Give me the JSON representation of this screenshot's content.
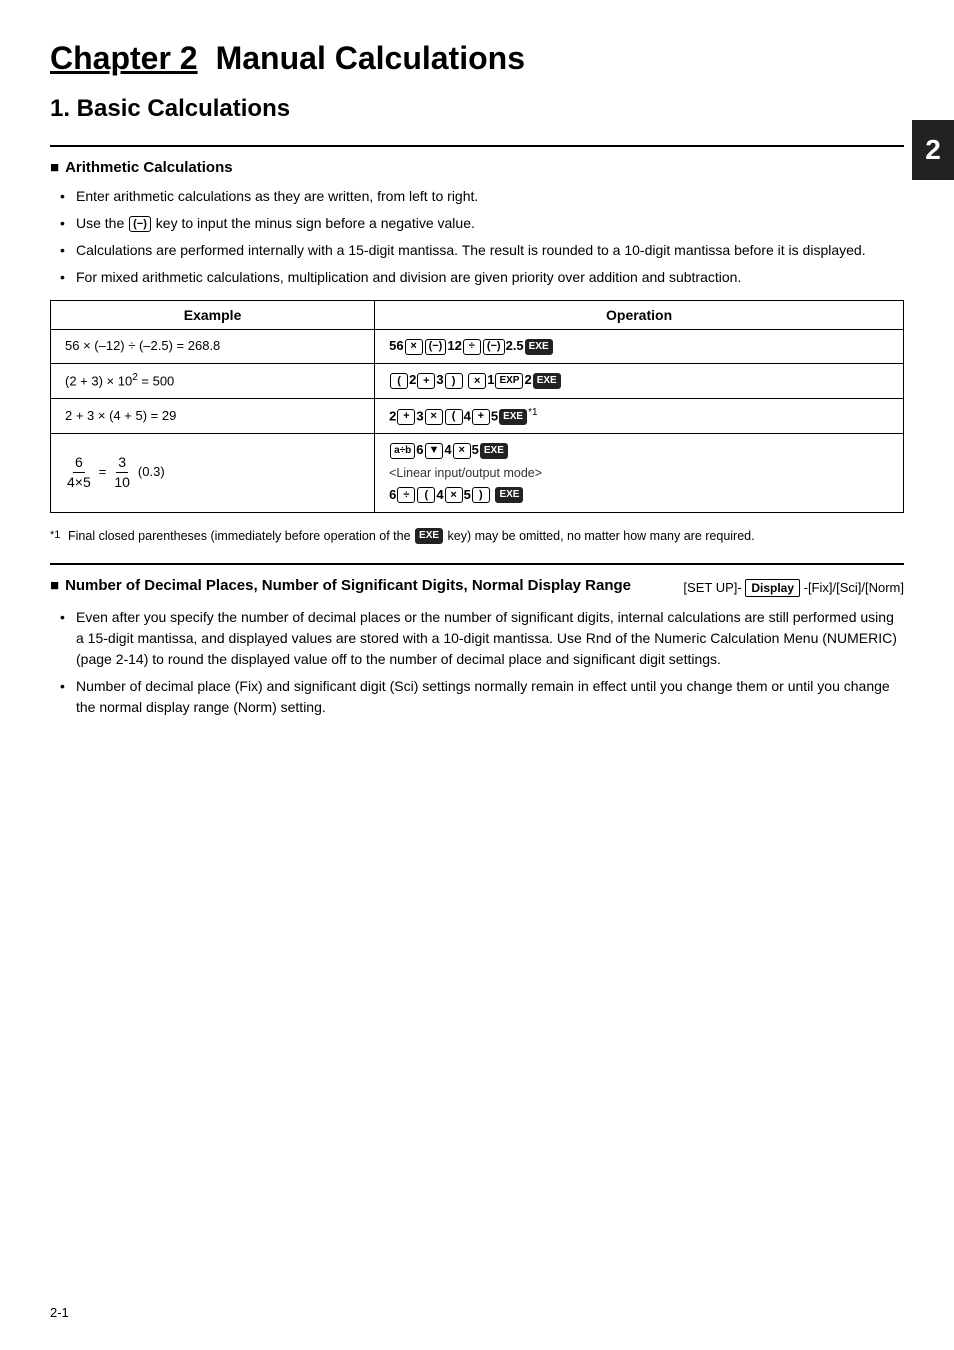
{
  "chapter": {
    "label": "Chapter 2",
    "title": "Manual Calculations",
    "section_tab": "2"
  },
  "section1": {
    "heading": "1. Basic Calculations"
  },
  "arithmetic": {
    "heading": "Arithmetic Calculations",
    "bullets": [
      "Enter arithmetic calculations as they are written, from left to right.",
      "Use the (−) key to input the minus sign before a negative value.",
      "Calculations are performed internally with a 15-digit mantissa. The result is rounded to a 10-digit mantissa before it is displayed.",
      "For mixed arithmetic calculations, multiplication and division are given priority over addition and subtraction."
    ],
    "table": {
      "col_example": "Example",
      "col_operation": "Operation",
      "rows": [
        {
          "example": "56 × (–12) ÷ (–2.5) = 268.8",
          "operation_text": "56 × (−) 12 ÷ (−) 2.5 EXE"
        },
        {
          "example": "(2 + 3) × 10² = 500",
          "operation_text": "( 2 + 3 ) × 1 EXP 2 EXE"
        },
        {
          "example": "2 + 3 × (4 + 5) = 29",
          "operation_text": "2 + 3 × ( 4 + 5 EXE *1"
        },
        {
          "example_frac": true,
          "example": "6 / (4×5) = 3/10 (0.3)",
          "operation_text_multi": true,
          "operation_line1": "a÷b 6 ▼ 4 × 5 EXE",
          "operation_line2": "<Linear input/output mode>",
          "operation_line3": "6 ÷ ( 4 × 5 ) EXE"
        }
      ]
    },
    "footnote": "Final closed parentheses (immediately before operation of the EXE key) may be omitted, no matter how many are required."
  },
  "ndp_section": {
    "heading": "Number of Decimal Places, Number of Significant Digits, Normal Display Range",
    "setup_ref": "[SET UP]- [Display] -[Fix]/[Sci]/[Norm]",
    "bullets": [
      "Even after you specify the number of decimal places or the number of significant digits, internal calculations are still performed using a 15-digit mantissa, and displayed values are stored with a 10-digit mantissa. Use Rnd of the Numeric Calculation Menu (NUMERIC) (page 2-14) to round the displayed value off to the number of decimal place and significant digit settings.",
      "Number of decimal place (Fix) and significant digit (Sci) settings normally remain in effect until you change them or until you change the normal display range (Norm) setting."
    ]
  },
  "page_number": "2-1"
}
